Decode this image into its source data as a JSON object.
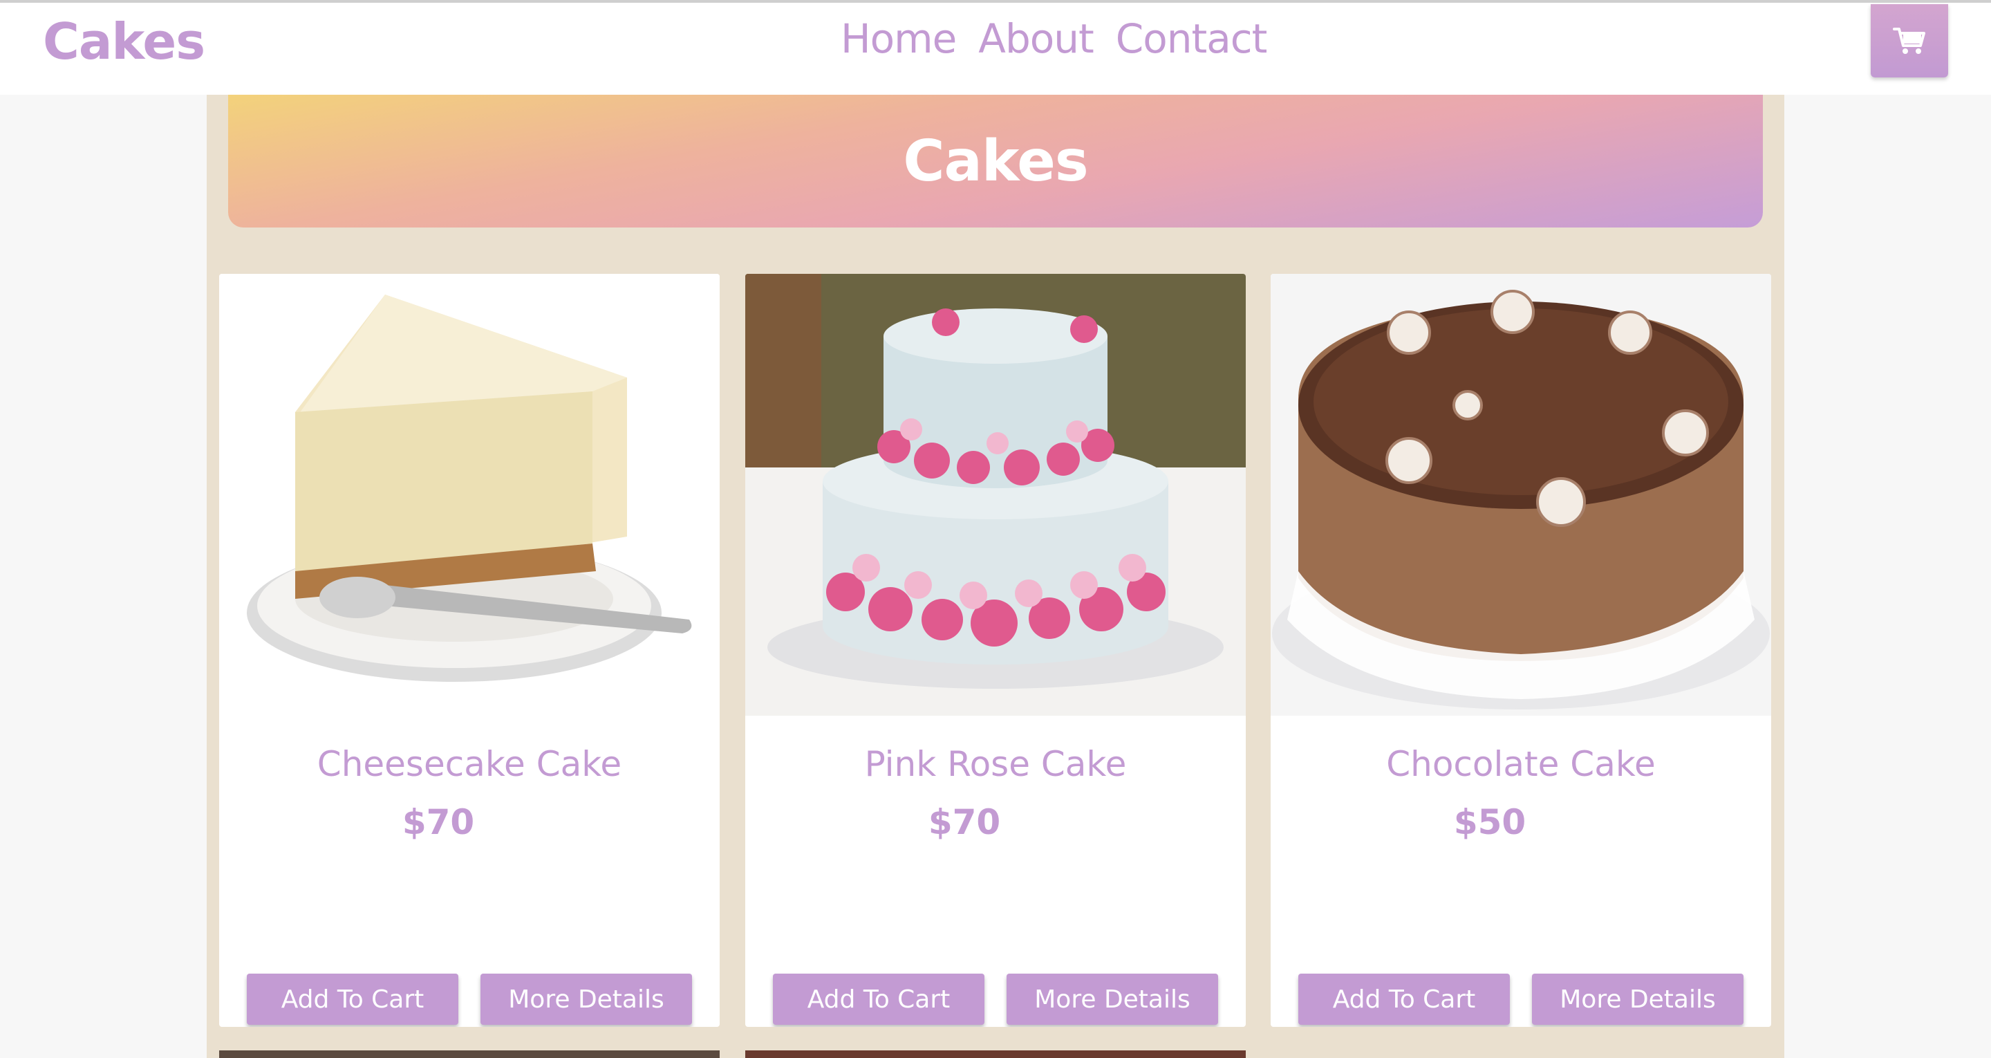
{
  "navbar": {
    "brand": "Cakes",
    "links": [
      "Home",
      "About",
      "Contact"
    ],
    "cart_icon": "cart-icon"
  },
  "banner": {
    "title": "Cakes"
  },
  "products": [
    {
      "name": "Cheesecake Cake",
      "price": "$70",
      "add_label": "Add To Cart",
      "details_label": "More Details",
      "image": "cheesecake-slice-image"
    },
    {
      "name": "Pink Rose Cake",
      "price": "$70",
      "add_label": "Add To Cart",
      "details_label": "More Details",
      "image": "pink-rose-cake-image"
    },
    {
      "name": "Chocolate Cake",
      "price": "$50",
      "add_label": "Add To Cart",
      "details_label": "More Details",
      "image": "chocolate-cake-image"
    }
  ],
  "colors": {
    "accent": "#c39bd3",
    "container_bg": "#eae0cf",
    "page_bg": "#f7f7f7"
  }
}
